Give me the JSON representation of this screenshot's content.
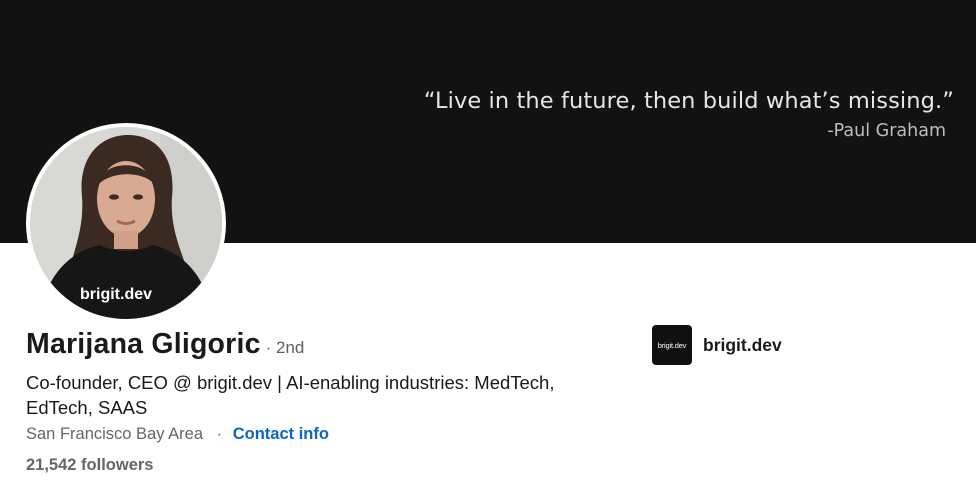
{
  "banner": {
    "quote": "“Live in the future, then build  what’s missing.”",
    "author": "-Paul Graham"
  },
  "profile": {
    "photo_shirt_text": "brigit.dev",
    "name": "Marijana Gligoric",
    "degree": "· 2nd",
    "headline": "Co-founder, CEO @ brigit.dev | AI-enabling industries: MedTech, EdTech, SAAS",
    "location": "San Francisco Bay Area",
    "separator": "·",
    "contact_info": "Contact info",
    "followers": "21,542 followers"
  },
  "company": {
    "logo_text": "brigit.dev",
    "name": "brigit.dev"
  },
  "colors": {
    "banner_bg": "#121212",
    "link": "#0a66c2"
  }
}
